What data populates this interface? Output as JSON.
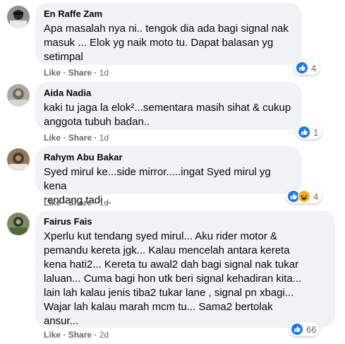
{
  "colors": {
    "bubble": "#f0f2f5",
    "meta_text": "#65676b",
    "like_blue": "#1877f2",
    "haha_yellow": "#f7b125"
  },
  "actions": {
    "like_label": "Like",
    "share_label": "Share",
    "separator": "·"
  },
  "comments": [
    {
      "author": "En Raffe Zam",
      "text": "Apa masalah nya ni.. tengok dia ada bagi signal nak\nmasuk ... Elok yg naik moto tu. Dapat balasan yg\nsetimpal",
      "time": "1d",
      "reactions": [
        "like-icon"
      ],
      "reaction_count": "4"
    },
    {
      "author": "Aida Nadia",
      "text": "kaki tu jaga la elok²...sementara masih sihat & cukup\nanggota tubuh badan..",
      "time": "1d",
      "reactions": [
        "like-icon"
      ],
      "reaction_count": "1"
    },
    {
      "author": "Rahym Abu Bakar",
      "text": "Syed mirul ke...side mirror.....ingat Syed mirul yg kena\nrendang tadi ..",
      "time": "1d",
      "reactions": [
        "like-icon",
        "haha-icon"
      ],
      "reaction_count": "4"
    },
    {
      "author": "Fairus Fais",
      "text": "Xperlu kut tendang syed mirul... Aku rider motor &\npemandu kereta jgk... Kalau mencelah antara kereta\nkena hati2... Kereta tu awal2 dah bagi signal nak tukar\nlaluan... Cuma bagi hon utk beri signal kehadiran kita...\nlain lah kalau jenis tiba2 tukar lane , signal pn xbagi...\nWajar lah kalau marah mcm tu... Sama2 bertolak\nansur...",
      "time": "2d",
      "reactions": [
        "like-icon"
      ],
      "reaction_count": "66"
    }
  ]
}
